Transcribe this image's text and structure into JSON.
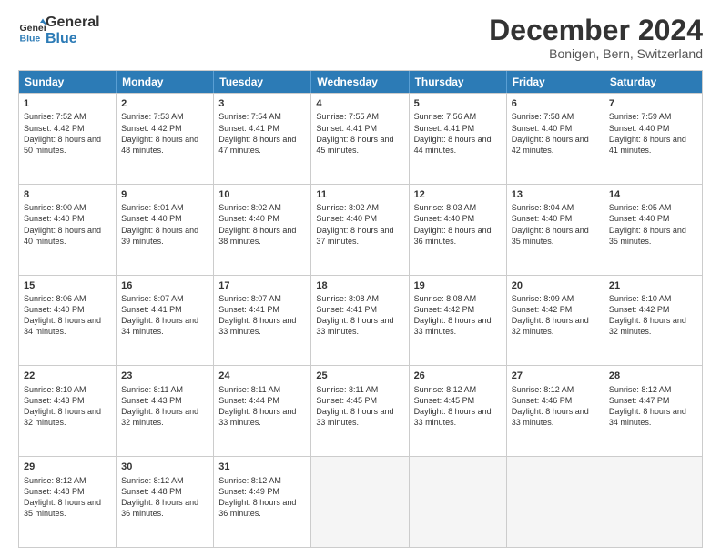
{
  "logo": {
    "line1": "General",
    "line2": "Blue"
  },
  "title": "December 2024",
  "subtitle": "Bonigen, Bern, Switzerland",
  "weekdays": [
    "Sunday",
    "Monday",
    "Tuesday",
    "Wednesday",
    "Thursday",
    "Friday",
    "Saturday"
  ],
  "weeks": [
    [
      {
        "day": "1",
        "rise": "Sunrise: 7:52 AM",
        "set": "Sunset: 4:42 PM",
        "daylight": "Daylight: 8 hours and 50 minutes."
      },
      {
        "day": "2",
        "rise": "Sunrise: 7:53 AM",
        "set": "Sunset: 4:42 PM",
        "daylight": "Daylight: 8 hours and 48 minutes."
      },
      {
        "day": "3",
        "rise": "Sunrise: 7:54 AM",
        "set": "Sunset: 4:41 PM",
        "daylight": "Daylight: 8 hours and 47 minutes."
      },
      {
        "day": "4",
        "rise": "Sunrise: 7:55 AM",
        "set": "Sunset: 4:41 PM",
        "daylight": "Daylight: 8 hours and 45 minutes."
      },
      {
        "day": "5",
        "rise": "Sunrise: 7:56 AM",
        "set": "Sunset: 4:41 PM",
        "daylight": "Daylight: 8 hours and 44 minutes."
      },
      {
        "day": "6",
        "rise": "Sunrise: 7:58 AM",
        "set": "Sunset: 4:40 PM",
        "daylight": "Daylight: 8 hours and 42 minutes."
      },
      {
        "day": "7",
        "rise": "Sunrise: 7:59 AM",
        "set": "Sunset: 4:40 PM",
        "daylight": "Daylight: 8 hours and 41 minutes."
      }
    ],
    [
      {
        "day": "8",
        "rise": "Sunrise: 8:00 AM",
        "set": "Sunset: 4:40 PM",
        "daylight": "Daylight: 8 hours and 40 minutes."
      },
      {
        "day": "9",
        "rise": "Sunrise: 8:01 AM",
        "set": "Sunset: 4:40 PM",
        "daylight": "Daylight: 8 hours and 39 minutes."
      },
      {
        "day": "10",
        "rise": "Sunrise: 8:02 AM",
        "set": "Sunset: 4:40 PM",
        "daylight": "Daylight: 8 hours and 38 minutes."
      },
      {
        "day": "11",
        "rise": "Sunrise: 8:02 AM",
        "set": "Sunset: 4:40 PM",
        "daylight": "Daylight: 8 hours and 37 minutes."
      },
      {
        "day": "12",
        "rise": "Sunrise: 8:03 AM",
        "set": "Sunset: 4:40 PM",
        "daylight": "Daylight: 8 hours and 36 minutes."
      },
      {
        "day": "13",
        "rise": "Sunrise: 8:04 AM",
        "set": "Sunset: 4:40 PM",
        "daylight": "Daylight: 8 hours and 35 minutes."
      },
      {
        "day": "14",
        "rise": "Sunrise: 8:05 AM",
        "set": "Sunset: 4:40 PM",
        "daylight": "Daylight: 8 hours and 35 minutes."
      }
    ],
    [
      {
        "day": "15",
        "rise": "Sunrise: 8:06 AM",
        "set": "Sunset: 4:40 PM",
        "daylight": "Daylight: 8 hours and 34 minutes."
      },
      {
        "day": "16",
        "rise": "Sunrise: 8:07 AM",
        "set": "Sunset: 4:41 PM",
        "daylight": "Daylight: 8 hours and 34 minutes."
      },
      {
        "day": "17",
        "rise": "Sunrise: 8:07 AM",
        "set": "Sunset: 4:41 PM",
        "daylight": "Daylight: 8 hours and 33 minutes."
      },
      {
        "day": "18",
        "rise": "Sunrise: 8:08 AM",
        "set": "Sunset: 4:41 PM",
        "daylight": "Daylight: 8 hours and 33 minutes."
      },
      {
        "day": "19",
        "rise": "Sunrise: 8:08 AM",
        "set": "Sunset: 4:42 PM",
        "daylight": "Daylight: 8 hours and 33 minutes."
      },
      {
        "day": "20",
        "rise": "Sunrise: 8:09 AM",
        "set": "Sunset: 4:42 PM",
        "daylight": "Daylight: 8 hours and 32 minutes."
      },
      {
        "day": "21",
        "rise": "Sunrise: 8:10 AM",
        "set": "Sunset: 4:42 PM",
        "daylight": "Daylight: 8 hours and 32 minutes."
      }
    ],
    [
      {
        "day": "22",
        "rise": "Sunrise: 8:10 AM",
        "set": "Sunset: 4:43 PM",
        "daylight": "Daylight: 8 hours and 32 minutes."
      },
      {
        "day": "23",
        "rise": "Sunrise: 8:11 AM",
        "set": "Sunset: 4:43 PM",
        "daylight": "Daylight: 8 hours and 32 minutes."
      },
      {
        "day": "24",
        "rise": "Sunrise: 8:11 AM",
        "set": "Sunset: 4:44 PM",
        "daylight": "Daylight: 8 hours and 33 minutes."
      },
      {
        "day": "25",
        "rise": "Sunrise: 8:11 AM",
        "set": "Sunset: 4:45 PM",
        "daylight": "Daylight: 8 hours and 33 minutes."
      },
      {
        "day": "26",
        "rise": "Sunrise: 8:12 AM",
        "set": "Sunset: 4:45 PM",
        "daylight": "Daylight: 8 hours and 33 minutes."
      },
      {
        "day": "27",
        "rise": "Sunrise: 8:12 AM",
        "set": "Sunset: 4:46 PM",
        "daylight": "Daylight: 8 hours and 33 minutes."
      },
      {
        "day": "28",
        "rise": "Sunrise: 8:12 AM",
        "set": "Sunset: 4:47 PM",
        "daylight": "Daylight: 8 hours and 34 minutes."
      }
    ],
    [
      {
        "day": "29",
        "rise": "Sunrise: 8:12 AM",
        "set": "Sunset: 4:48 PM",
        "daylight": "Daylight: 8 hours and 35 minutes."
      },
      {
        "day": "30",
        "rise": "Sunrise: 8:12 AM",
        "set": "Sunset: 4:48 PM",
        "daylight": "Daylight: 8 hours and 36 minutes."
      },
      {
        "day": "31",
        "rise": "Sunrise: 8:12 AM",
        "set": "Sunset: 4:49 PM",
        "daylight": "Daylight: 8 hours and 36 minutes."
      },
      null,
      null,
      null,
      null
    ]
  ]
}
